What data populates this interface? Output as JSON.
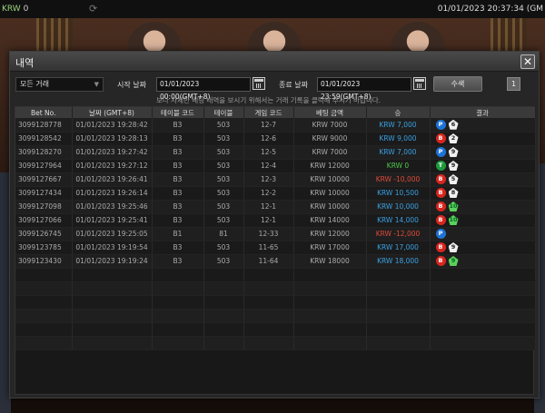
{
  "topbar": {
    "currency": "KRW",
    "balance": "0",
    "clock": "01/01/2023 20:37:34 (GM"
  },
  "modal": {
    "title": "내역",
    "filter_select": "모든 거래",
    "start_label": "시작 날짜",
    "start_value": "01/01/2023 00:00(GMT+8)",
    "end_label": "종료 날짜",
    "end_value": "01/01/2023 23:59(GMT+8)",
    "query_label": "수색",
    "page": "1",
    "notice": "보다 자세한 베팅 내역을 보시기 위해서는 거래 기록을 클릭해 주시기 바랍니다."
  },
  "table": {
    "headers": [
      "Bet No.",
      "날짜 (GMT+8)",
      "테이블 코드",
      "테이블",
      "게임 코드",
      "베팅 금액",
      "승",
      "결과"
    ],
    "rows": [
      {
        "no": "3099128778",
        "date": "01/01/2023 19:28:42",
        "code": "B3",
        "table": "503",
        "game": "12-7",
        "bet": "KRW 7000",
        "win": "KRW 7,000",
        "win_color": "blue",
        "res": [
          [
            "P",
            "6",
            "w"
          ]
        ]
      },
      {
        "no": "3099128542",
        "date": "01/01/2023 19:28:13",
        "code": "B3",
        "table": "503",
        "game": "12-6",
        "bet": "KRW 9000",
        "win": "KRW 9,000",
        "win_color": "blue",
        "res": [
          [
            "B",
            "2",
            "w"
          ]
        ]
      },
      {
        "no": "3099128270",
        "date": "01/01/2023 19:27:42",
        "code": "B3",
        "table": "503",
        "game": "12-5",
        "bet": "KRW 7000",
        "win": "KRW 7,000",
        "win_color": "blue",
        "res": [
          [
            "P",
            "9",
            "w"
          ]
        ]
      },
      {
        "no": "3099127964",
        "date": "01/01/2023 19:27:12",
        "code": "B3",
        "table": "503",
        "game": "12-4",
        "bet": "KRW 12000",
        "win": "KRW 0",
        "win_color": "green",
        "res": [
          [
            "T",
            "9",
            "w"
          ]
        ]
      },
      {
        "no": "3099127667",
        "date": "01/01/2023 19:26:41",
        "code": "B3",
        "table": "503",
        "game": "12-3",
        "bet": "KRW 10000",
        "win": "KRW -10,000",
        "win_color": "red",
        "res": [
          [
            "B",
            "5",
            "w"
          ]
        ]
      },
      {
        "no": "3099127434",
        "date": "01/01/2023 19:26:14",
        "code": "B3",
        "table": "503",
        "game": "12-2",
        "bet": "KRW 10000",
        "win": "KRW 10,500",
        "win_color": "blue",
        "res": [
          [
            "B",
            "8",
            "w"
          ]
        ]
      },
      {
        "no": "3099127098",
        "date": "01/01/2023 19:25:46",
        "code": "B3",
        "table": "503",
        "game": "12-1",
        "bet": "KRW 10000",
        "win": "KRW 10,000",
        "win_color": "blue",
        "res": [
          [
            "B",
            "10",
            "g"
          ]
        ]
      },
      {
        "no": "3099127066",
        "date": "01/01/2023 19:25:41",
        "code": "B3",
        "table": "503",
        "game": "12-1",
        "bet": "KRW 14000",
        "win": "KRW 14,000",
        "win_color": "blue",
        "res": [
          [
            "B",
            "10",
            "g"
          ]
        ]
      },
      {
        "no": "3099126745",
        "date": "01/01/2023 19:25:05",
        "code": "B1",
        "table": "81",
        "game": "12-33",
        "bet": "KRW 12000",
        "win": "KRW -12,000",
        "win_color": "red",
        "res": [
          [
            "P",
            "",
            ""
          ]
        ]
      },
      {
        "no": "3099123785",
        "date": "01/01/2023 19:19:54",
        "code": "B3",
        "table": "503",
        "game": "11-65",
        "bet": "KRW 17000",
        "win": "KRW 17,000",
        "win_color": "blue",
        "res": [
          [
            "B",
            "9",
            "w"
          ]
        ]
      },
      {
        "no": "3099123430",
        "date": "01/01/2023 19:19:24",
        "code": "B3",
        "table": "503",
        "game": "11-64",
        "bet": "KRW 18000",
        "win": "KRW 18,000",
        "win_color": "blue",
        "res": [
          [
            "B",
            "9",
            "g"
          ]
        ]
      }
    ]
  }
}
